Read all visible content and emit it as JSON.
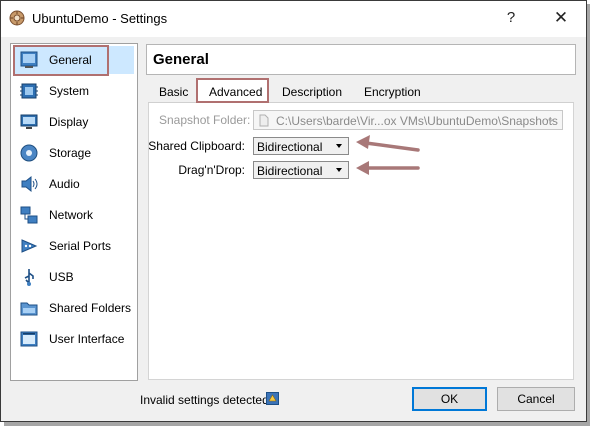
{
  "window": {
    "title": "UbuntuDemo - Settings",
    "help_glyph": "?",
    "close_glyph": "✕"
  },
  "sidebar": {
    "items": [
      {
        "label": "General",
        "icon": "general-icon"
      },
      {
        "label": "System",
        "icon": "system-icon"
      },
      {
        "label": "Display",
        "icon": "display-icon"
      },
      {
        "label": "Storage",
        "icon": "storage-icon"
      },
      {
        "label": "Audio",
        "icon": "audio-icon"
      },
      {
        "label": "Network",
        "icon": "network-icon"
      },
      {
        "label": "Serial Ports",
        "icon": "serial-ports-icon"
      },
      {
        "label": "USB",
        "icon": "usb-icon"
      },
      {
        "label": "Shared Folders",
        "icon": "shared-folders-icon"
      },
      {
        "label": "User Interface",
        "icon": "user-interface-icon"
      }
    ],
    "selected": "General"
  },
  "header": {
    "title": "General"
  },
  "tabs": [
    {
      "label": "Basic"
    },
    {
      "label": "Advanced"
    },
    {
      "label": "Description"
    },
    {
      "label": "Encryption"
    }
  ],
  "active_tab": "Advanced",
  "form": {
    "snapshot_folder_label": "Snapshot Folder:",
    "snapshot_folder_value": "C:\\Users\\barde\\Vir...ox VMs\\UbuntuDemo\\Snapshots",
    "shared_clipboard_label": "Shared Clipboard:",
    "shared_clipboard_value": "Bidirectional",
    "drag_drop_label": "Drag'n'Drop:",
    "drag_drop_value": "Bidirectional"
  },
  "footer": {
    "status_text": "Invalid settings detected",
    "ok_label": "OK",
    "cancel_label": "Cancel"
  },
  "colors": {
    "accent": "#0078d7",
    "selected_bg": "#cde8ff",
    "annotation": "#a87878"
  }
}
